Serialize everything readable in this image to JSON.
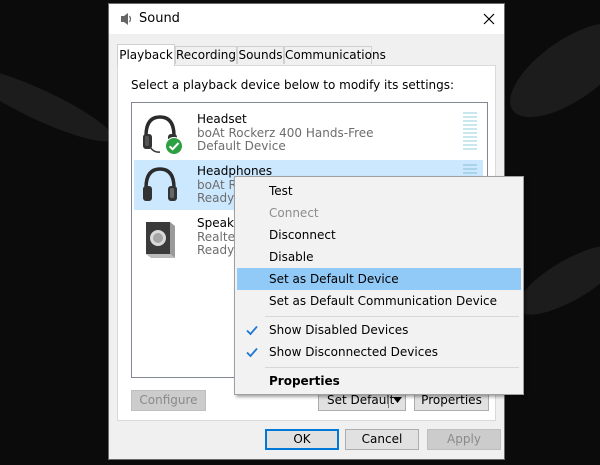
{
  "window": {
    "title": "Sound",
    "close_glyph": "✕"
  },
  "tabs": [
    {
      "label": "Playback",
      "active": true
    },
    {
      "label": "Recording"
    },
    {
      "label": "Sounds"
    },
    {
      "label": "Communications"
    }
  ],
  "playback": {
    "instruction": "Select a playback device below to modify its settings:",
    "devices": [
      {
        "name": "Headset",
        "description": "boAt Rockerz 400 Hands-Free",
        "status": "Default Device",
        "icon": "headset-icon",
        "default_badge": "check-badge-icon"
      },
      {
        "name": "Headphones",
        "description": "boAt Rockerz 400 Stereo",
        "description_visible": "boAt Ro",
        "status": "Ready",
        "icon": "headphones-icon",
        "selected": true
      },
      {
        "name": "Speakers",
        "name_visible": "Speake",
        "description": "Realtek",
        "description_visible": "Realtek",
        "status": "Ready",
        "icon": "speaker-icon"
      }
    ]
  },
  "buttons": {
    "configure": "Configure",
    "set_default": "Set Default",
    "properties": "Properties",
    "ok": "OK",
    "cancel": "Cancel",
    "apply": "Apply"
  },
  "context_menu": {
    "items": [
      {
        "label": "Test"
      },
      {
        "label": "Connect",
        "disabled": true
      },
      {
        "label": "Disconnect"
      },
      {
        "label": "Disable"
      },
      {
        "label": "Set as Default Device",
        "highlighted": true
      },
      {
        "label": "Set as Default Communication Device"
      },
      {
        "label": "Show Disabled Devices",
        "checked": true
      },
      {
        "label": "Show Disconnected Devices",
        "checked": true
      },
      {
        "label": "Properties",
        "bold": true
      }
    ]
  },
  "colors": {
    "selection": "#cce8ff",
    "menu_highlight": "#91c9f7",
    "check": "#1e78d6",
    "default_badge": "#2ea043",
    "level_meter": "#c9e7f1"
  }
}
